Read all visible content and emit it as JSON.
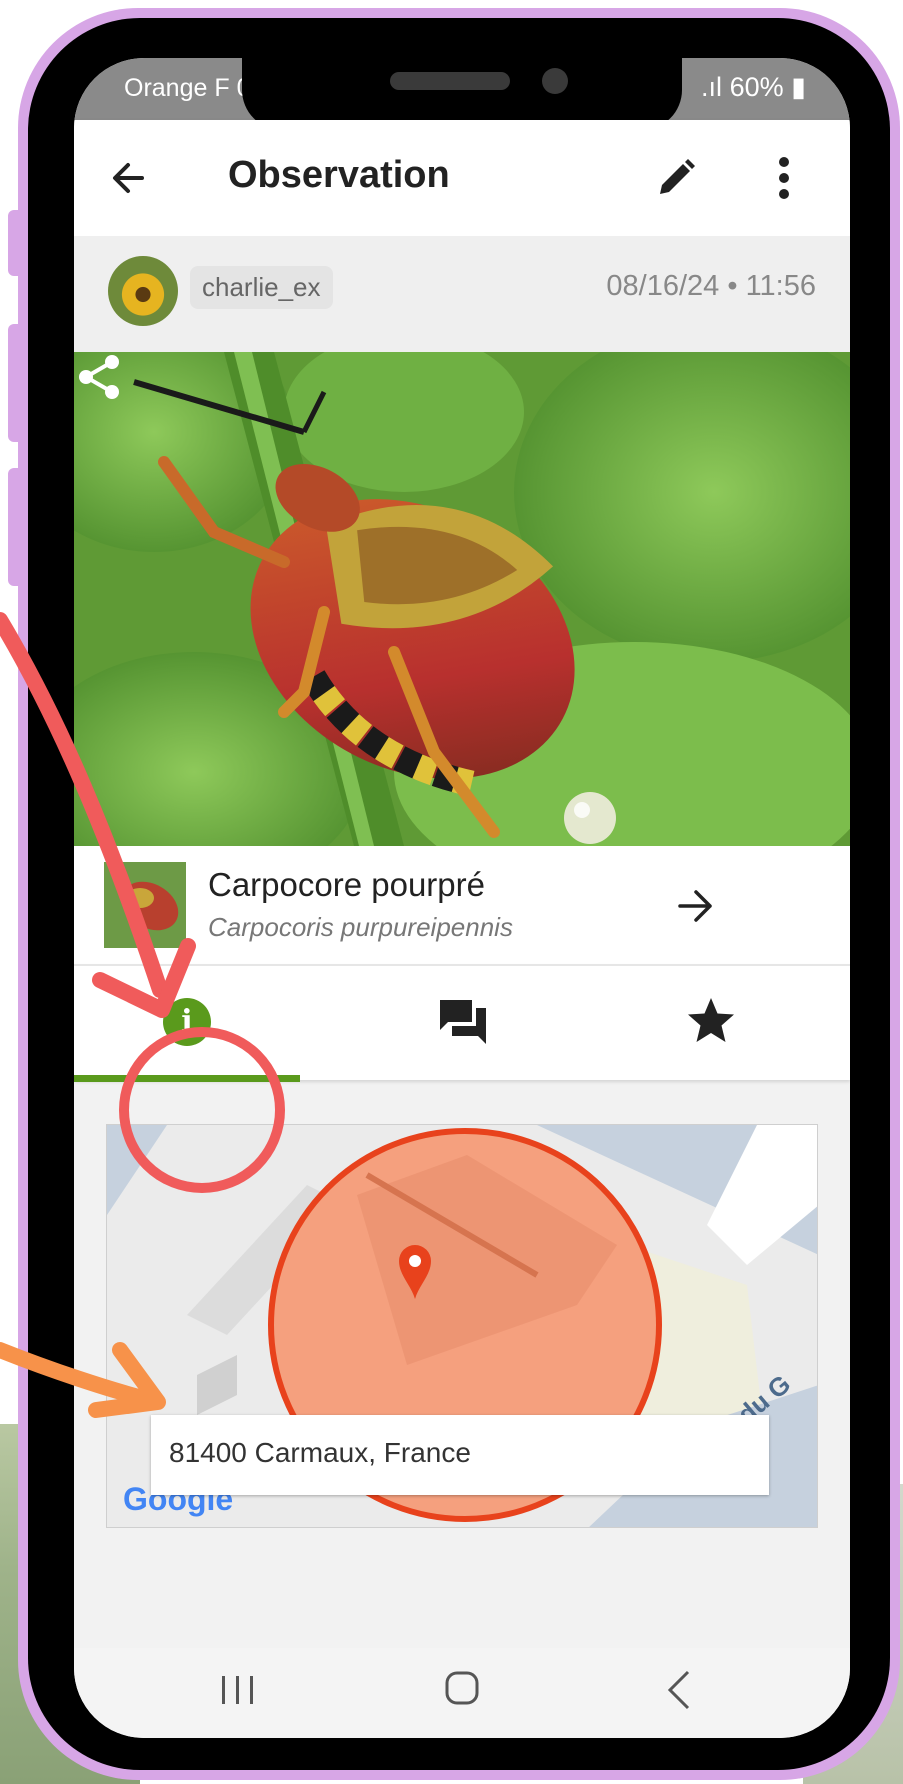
{
  "status_bar": {
    "carrier": "Orange F",
    "time_partial": "0",
    "battery": "60%"
  },
  "app_bar": {
    "title": "Observation",
    "back_icon": "arrow-left-icon",
    "edit_icon": "pencil-icon",
    "more_icon": "more-vertical-icon"
  },
  "observer": {
    "username": "charlie_ex",
    "datetime": "08/16/24 • 11:56"
  },
  "photo": {
    "share_icon": "share-icon"
  },
  "taxon": {
    "common_name": "Carpocore pourpré",
    "scientific_name": "Carpocoris purpureipennis",
    "arrow_icon": "arrow-right-icon"
  },
  "tabs": [
    {
      "icon": "info-icon",
      "glyph": "i",
      "active": true
    },
    {
      "icon": "comments-icon",
      "active": false
    },
    {
      "icon": "star-icon",
      "active": false
    }
  ],
  "map": {
    "address": "81400 Carmaux, France",
    "street_fragment": "du G",
    "google_logo": "Google"
  },
  "nav_bar": {
    "icons": [
      "recents-icon",
      "home-icon",
      "back-icon"
    ]
  },
  "colors": {
    "accent_green": "#5a9a1c",
    "phone_frame": "#d7a6e6",
    "annotation_red": "#f05b5b",
    "annotation_orange": "#f7924a",
    "map_circle": "#f5a07e",
    "map_pin": "#e8421c"
  }
}
